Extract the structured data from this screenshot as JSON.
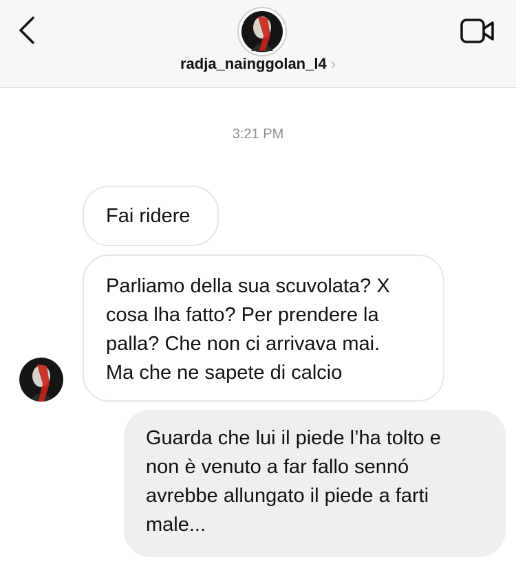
{
  "header": {
    "username": "radja_nainggolan_l4",
    "chevron": "›",
    "back_icon": "chevron-left-icon",
    "video_icon": "video-camera-icon"
  },
  "thread": {
    "timestamp": "3:21 PM",
    "messages": [
      {
        "direction": "incoming",
        "lines": [
          "Fai ridere"
        ]
      },
      {
        "direction": "incoming",
        "lines": [
          "Parliamo della sua scuvolata? X",
          "cosa lha fatto? Per prendere la",
          "palla? Che non ci arrivava mai.",
          "Ma che ne sapete di calcio"
        ]
      },
      {
        "direction": "outgoing",
        "lines": [
          "Guarda che lui il piede l’ha tolto e",
          "non è venuto a far fallo sennó",
          "avrebbe allungato il piede a farti",
          "male..."
        ]
      }
    ]
  },
  "colors": {
    "header_bg": "#f7f7f7",
    "incoming_border": "#e6e6e6",
    "outgoing_bg": "#efefef",
    "timestamp": "#8e8e8e",
    "avatar_red": "#c8231b"
  }
}
